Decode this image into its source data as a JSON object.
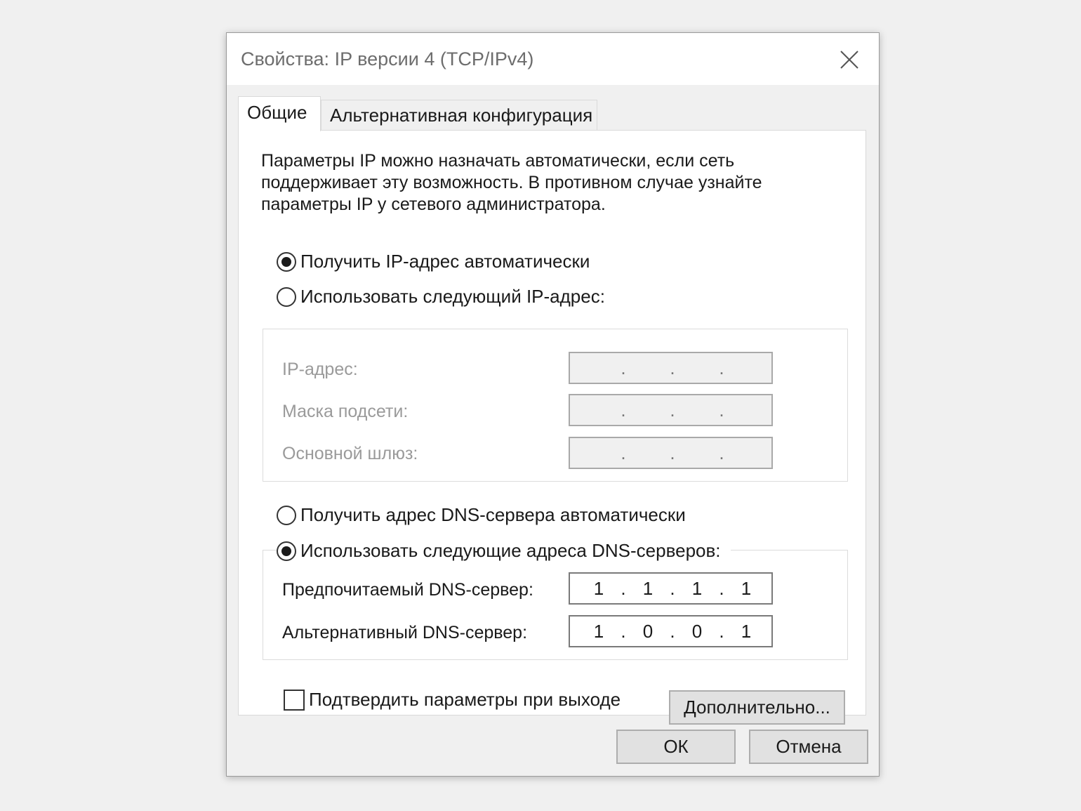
{
  "window": {
    "title": "Свойства: IP версии 4 (TCP/IPv4)"
  },
  "tabs": [
    {
      "label": "Общие",
      "selected": true
    },
    {
      "label": "Альтернативная конфигурация",
      "selected": false
    }
  ],
  "intro_lines": [
    "Параметры IP можно назначать автоматически, если сеть",
    "поддерживает эту возможность. В противном случае узнайте",
    "параметры IP у сетевого администратора."
  ],
  "ip_mode": {
    "auto_label": "Получить IP-адрес автоматически",
    "manual_label": "Использовать следующий IP-адрес:",
    "selected": "auto"
  },
  "ip_fields": {
    "ip_address": {
      "label": "IP-адрес:",
      "octets": [
        "",
        "",
        "",
        ""
      ]
    },
    "subnet_mask": {
      "label": "Маска подсети:",
      "octets": [
        "",
        "",
        "",
        ""
      ]
    },
    "default_gateway": {
      "label": "Основной шлюз:",
      "octets": [
        "",
        "",
        "",
        ""
      ]
    }
  },
  "dns_mode": {
    "auto_label": "Получить адрес DNS-сервера автоматически",
    "manual_label": "Использовать следующие адреса DNS-серверов:",
    "selected": "manual"
  },
  "dns_fields": {
    "preferred": {
      "label": "Предпочитаемый DNS-сервер:",
      "octets": [
        "1",
        "1",
        "1",
        "1"
      ]
    },
    "alternate": {
      "label": "Альтернативный DNS-сервер:",
      "octets": [
        "1",
        "0",
        "0",
        "1"
      ]
    }
  },
  "validate_on_exit": {
    "label": "Подтвердить параметры при выходе",
    "checked": false
  },
  "buttons": {
    "advanced": "Дополнительно...",
    "ok": "ОК",
    "cancel": "Отмена"
  },
  "icons": {
    "close": "close-icon"
  }
}
